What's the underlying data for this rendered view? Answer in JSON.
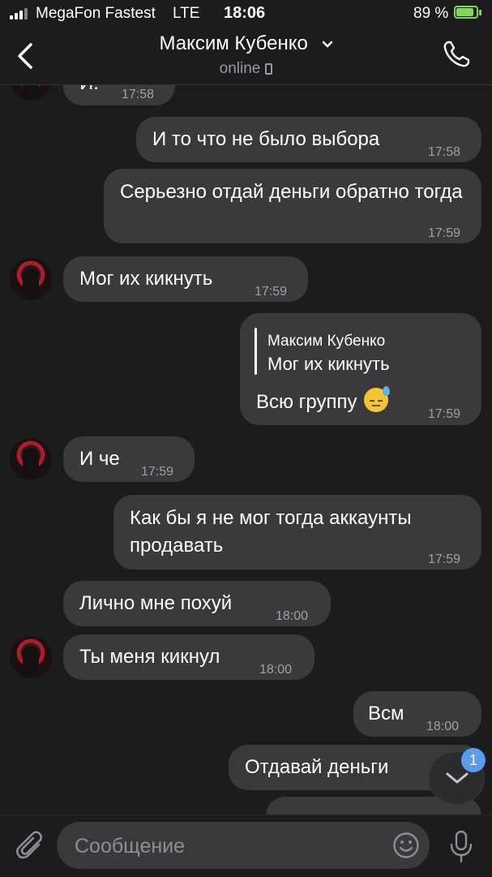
{
  "status_bar": {
    "carrier": "MegaFon Fastest",
    "network": "LTE",
    "time": "18:06",
    "battery": "89 %"
  },
  "header": {
    "contact_name": "Максим Кубенко",
    "presence": "online"
  },
  "messages": [
    {
      "side": "in",
      "text": "И.",
      "time": "17:58"
    },
    {
      "side": "out",
      "text": "И то что не было выбора",
      "time": "17:58"
    },
    {
      "side": "out",
      "text": "Серьезно отдай деньги обратно тогда",
      "time": "17:59"
    },
    {
      "side": "in",
      "text": "Мог их кикнуть",
      "time": "17:59"
    },
    {
      "side": "out",
      "reply_to": {
        "name": "Максим Кубенко",
        "text": "Мог их кикнуть"
      },
      "text": "Всю группу",
      "emoji": "downcast-face-with-sweat",
      "time": "17:59"
    },
    {
      "side": "in",
      "text": "И че",
      "time": "17:59"
    },
    {
      "side": "out",
      "text": "Как бы я не мог тогда аккаунты продавать",
      "time": "17:59"
    },
    {
      "side": "in",
      "text": "Лично мне похуй",
      "time": "18:00"
    },
    {
      "side": "in",
      "text": "Ты меня кикнул",
      "time": "18:00"
    },
    {
      "side": "out",
      "text": "Всм",
      "time": "18:00"
    },
    {
      "side": "out",
      "text": "Отдавай деньги",
      "time": ""
    }
  ],
  "scroll_down": {
    "unread_badge": "1"
  },
  "composer": {
    "placeholder": "Сообщение"
  },
  "colors": {
    "background": "#1c1c1e",
    "bubble": "#3a3a3c",
    "accent": "#5b9bea",
    "battery": "#7ed957"
  }
}
